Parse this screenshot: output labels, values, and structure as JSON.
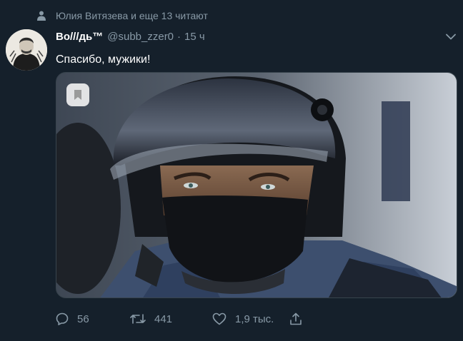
{
  "social_context": {
    "text": "Юлия Витязева и еще 13 читают",
    "icon": "person-icon"
  },
  "tweet": {
    "author_name": "Во///дь™",
    "author_handle": "@subb_zzer0",
    "separator": "·",
    "time": "15 ч",
    "text": "Спасибо, мужики!",
    "media": {
      "description_icon": "bookmark-icon"
    }
  },
  "actions": {
    "reply_count": "56",
    "retweet_count": "441",
    "like_count": "1,9 тыс.",
    "share_icon": "share-icon"
  },
  "colors": {
    "background": "#15202b",
    "secondary_text": "#8899a6",
    "primary_text": "#ffffff",
    "border": "#38444d"
  }
}
